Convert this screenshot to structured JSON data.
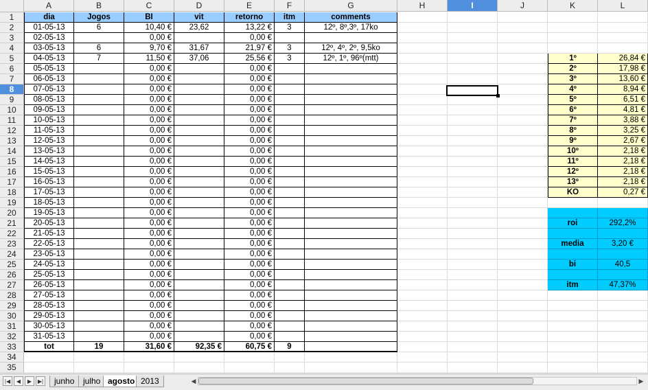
{
  "columns": [
    "A",
    "B",
    "C",
    "D",
    "E",
    "F",
    "G",
    "H",
    "I",
    "J",
    "K",
    "L"
  ],
  "selected_column": "I",
  "selected_row": "8",
  "row_numbers": [
    "1",
    "2",
    "3",
    "4",
    "5",
    "6",
    "7",
    "8",
    "9",
    "10",
    "11",
    "12",
    "13",
    "14",
    "15",
    "16",
    "17",
    "18",
    "19",
    "20",
    "21",
    "22",
    "23",
    "24",
    "25",
    "26",
    "27",
    "28",
    "29",
    "30",
    "31",
    "32",
    "33",
    "34",
    "35"
  ],
  "headers": {
    "dia": "dia",
    "jogos": "Jogos",
    "bi": "BI",
    "vit": "vit",
    "retorno": "retorno",
    "itm": "itm",
    "comments": "comments"
  },
  "rows": [
    {
      "dia": "01-05-13",
      "jogos": "6",
      "bi": "10,40 €",
      "vit": "23,62",
      "retorno": "13,22 €",
      "itm": "3",
      "comments": "12º, 8º,3º, 17ko"
    },
    {
      "dia": "02-05-13",
      "jogos": "",
      "bi": "0,00 €",
      "vit": "",
      "retorno": "0,00 €",
      "itm": "",
      "comments": ""
    },
    {
      "dia": "03-05-13",
      "jogos": "6",
      "bi": "9,70 €",
      "vit": "31,67",
      "retorno": "21,97 €",
      "itm": "3",
      "comments": "12º, 4º, 2º, 9,5ko"
    },
    {
      "dia": "04-05-13",
      "jogos": "7",
      "bi": "11,50 €",
      "vit": "37,06",
      "retorno": "25,56 €",
      "itm": "3",
      "comments": "12º, 1º, 96º(mtt)"
    },
    {
      "dia": "05-05-13",
      "jogos": "",
      "bi": "0,00 €",
      "vit": "",
      "retorno": "0,00 €",
      "itm": "",
      "comments": ""
    },
    {
      "dia": "06-05-13",
      "jogos": "",
      "bi": "0,00 €",
      "vit": "",
      "retorno": "0,00 €",
      "itm": "",
      "comments": ""
    },
    {
      "dia": "07-05-13",
      "jogos": "",
      "bi": "0,00 €",
      "vit": "",
      "retorno": "0,00 €",
      "itm": "",
      "comments": ""
    },
    {
      "dia": "08-05-13",
      "jogos": "",
      "bi": "0,00 €",
      "vit": "",
      "retorno": "0,00 €",
      "itm": "",
      "comments": ""
    },
    {
      "dia": "09-05-13",
      "jogos": "",
      "bi": "0,00 €",
      "vit": "",
      "retorno": "0,00 €",
      "itm": "",
      "comments": ""
    },
    {
      "dia": "10-05-13",
      "jogos": "",
      "bi": "0,00 €",
      "vit": "",
      "retorno": "0,00 €",
      "itm": "",
      "comments": ""
    },
    {
      "dia": "11-05-13",
      "jogos": "",
      "bi": "0,00 €",
      "vit": "",
      "retorno": "0,00 €",
      "itm": "",
      "comments": ""
    },
    {
      "dia": "12-05-13",
      "jogos": "",
      "bi": "0,00 €",
      "vit": "",
      "retorno": "0,00 €",
      "itm": "",
      "comments": ""
    },
    {
      "dia": "13-05-13",
      "jogos": "",
      "bi": "0,00 €",
      "vit": "",
      "retorno": "0,00 €",
      "itm": "",
      "comments": ""
    },
    {
      "dia": "14-05-13",
      "jogos": "",
      "bi": "0,00 €",
      "vit": "",
      "retorno": "0,00 €",
      "itm": "",
      "comments": ""
    },
    {
      "dia": "15-05-13",
      "jogos": "",
      "bi": "0,00 €",
      "vit": "",
      "retorno": "0,00 €",
      "itm": "",
      "comments": ""
    },
    {
      "dia": "16-05-13",
      "jogos": "",
      "bi": "0,00 €",
      "vit": "",
      "retorno": "0,00 €",
      "itm": "",
      "comments": ""
    },
    {
      "dia": "17-05-13",
      "jogos": "",
      "bi": "0,00 €",
      "vit": "",
      "retorno": "0,00 €",
      "itm": "",
      "comments": ""
    },
    {
      "dia": "18-05-13",
      "jogos": "",
      "bi": "0,00 €",
      "vit": "",
      "retorno": "0,00 €",
      "itm": "",
      "comments": ""
    },
    {
      "dia": "19-05-13",
      "jogos": "",
      "bi": "0,00 €",
      "vit": "",
      "retorno": "0,00 €",
      "itm": "",
      "comments": ""
    },
    {
      "dia": "20-05-13",
      "jogos": "",
      "bi": "0,00 €",
      "vit": "",
      "retorno": "0,00 €",
      "itm": "",
      "comments": ""
    },
    {
      "dia": "21-05-13",
      "jogos": "",
      "bi": "0,00 €",
      "vit": "",
      "retorno": "0,00 €",
      "itm": "",
      "comments": ""
    },
    {
      "dia": "22-05-13",
      "jogos": "",
      "bi": "0,00 €",
      "vit": "",
      "retorno": "0,00 €",
      "itm": "",
      "comments": ""
    },
    {
      "dia": "23-05-13",
      "jogos": "",
      "bi": "0,00 €",
      "vit": "",
      "retorno": "0,00 €",
      "itm": "",
      "comments": ""
    },
    {
      "dia": "24-05-13",
      "jogos": "",
      "bi": "0,00 €",
      "vit": "",
      "retorno": "0,00 €",
      "itm": "",
      "comments": ""
    },
    {
      "dia": "25-05-13",
      "jogos": "",
      "bi": "0,00 €",
      "vit": "",
      "retorno": "0,00 €",
      "itm": "",
      "comments": ""
    },
    {
      "dia": "26-05-13",
      "jogos": "",
      "bi": "0,00 €",
      "vit": "",
      "retorno": "0,00 €",
      "itm": "",
      "comments": ""
    },
    {
      "dia": "27-05-13",
      "jogos": "",
      "bi": "0,00 €",
      "vit": "",
      "retorno": "0,00 €",
      "itm": "",
      "comments": ""
    },
    {
      "dia": "28-05-13",
      "jogos": "",
      "bi": "0,00 €",
      "vit": "",
      "retorno": "0,00 €",
      "itm": "",
      "comments": ""
    },
    {
      "dia": "29-05-13",
      "jogos": "",
      "bi": "0,00 €",
      "vit": "",
      "retorno": "0,00 €",
      "itm": "",
      "comments": ""
    },
    {
      "dia": "30-05-13",
      "jogos": "",
      "bi": "0,00 €",
      "vit": "",
      "retorno": "0,00 €",
      "itm": "",
      "comments": ""
    },
    {
      "dia": "31-05-13",
      "jogos": "",
      "bi": "0,00 €",
      "vit": "",
      "retorno": "0,00 €",
      "itm": "",
      "comments": ""
    }
  ],
  "totals": {
    "label": "tot",
    "jogos": "19",
    "bi": "31,60 €",
    "vit": "92,35 €",
    "retorno": "60,75 €",
    "itm": "9"
  },
  "prizes": [
    {
      "pos": "1º",
      "value": "26,84 €"
    },
    {
      "pos": "2º",
      "value": "17,98 €"
    },
    {
      "pos": "3º",
      "value": "13,60 €"
    },
    {
      "pos": "4º",
      "value": "8,94 €"
    },
    {
      "pos": "5º",
      "value": "6,51 €"
    },
    {
      "pos": "6º",
      "value": "4,81 €"
    },
    {
      "pos": "7º",
      "value": "3,88 €"
    },
    {
      "pos": "8º",
      "value": "3,25 €"
    },
    {
      "pos": "9º",
      "value": "2,67 €"
    },
    {
      "pos": "10º",
      "value": "2,18 €"
    },
    {
      "pos": "11º",
      "value": "2,18 €"
    },
    {
      "pos": "12º",
      "value": "2,18 €"
    },
    {
      "pos": "13º",
      "value": "2,18 €"
    },
    {
      "pos": "KO",
      "value": "0,27 €"
    }
  ],
  "stats": [
    {
      "label": "",
      "value": ""
    },
    {
      "label": "roi",
      "value": "292,2%"
    },
    {
      "label": "",
      "value": ""
    },
    {
      "label": "media",
      "value": "3,20 €"
    },
    {
      "label": "",
      "value": ""
    },
    {
      "label": "bi",
      "value": "40,5"
    },
    {
      "label": "",
      "value": ""
    },
    {
      "label": "itm",
      "value": "47,37%"
    }
  ],
  "sheet_tabs": [
    "junho",
    "julho",
    "agosto",
    "2013"
  ],
  "active_tab": "agosto",
  "colors": {
    "header_blue": "#99ccff",
    "prize_yellow": "#ffffcc",
    "stats_cyan": "#00ccff",
    "selection_blue": "#4f8fde"
  },
  "icons": {
    "first": "first-sheet-icon",
    "prev": "prev-sheet-icon",
    "next": "next-sheet-icon",
    "last": "last-sheet-icon"
  }
}
